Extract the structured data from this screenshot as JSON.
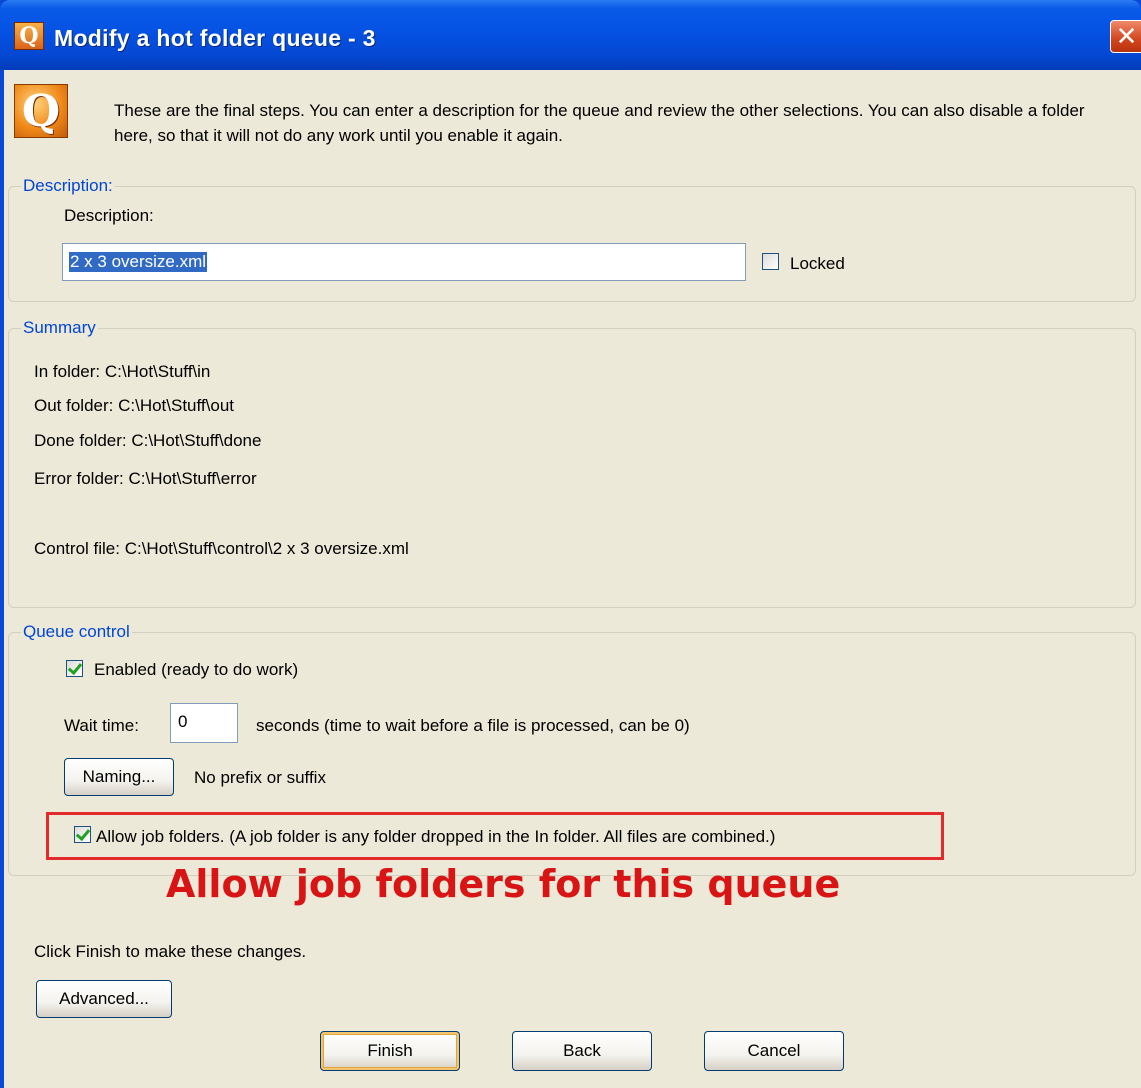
{
  "window": {
    "title": "Modify a hot folder queue - 3",
    "close_glyph": "✕",
    "app_icon_letter": "Q"
  },
  "intro": {
    "icon_letter": "Q",
    "text": "These are the final steps. You can enter a description for the queue and review the other selections. You can also disable a folder here, so that it will not do any work until you enable it again."
  },
  "description_group": {
    "legend": "Description:",
    "label": "Description:",
    "value": "2 x 3 oversize.xml",
    "locked_label": "Locked",
    "locked_checked": false
  },
  "summary_group": {
    "legend": "Summary",
    "in_folder": "In folder:  C:\\Hot\\Stuff\\in",
    "out_folder": "Out folder:  C:\\Hot\\Stuff\\out",
    "done_folder": "Done folder:  C:\\Hot\\Stuff\\done",
    "error_folder": "Error folder:  C:\\Hot\\Stuff\\error",
    "control_file": "Control file:  C:\\Hot\\Stuff\\control\\2 x 3 oversize.xml"
  },
  "queue_control": {
    "legend": "Queue control",
    "enabled_label": "Enabled (ready to do work)",
    "enabled_checked": true,
    "wait_label": "Wait time:",
    "wait_value": "0",
    "wait_hint": "seconds (time to wait before a file is processed, can be 0)",
    "naming_button": "Naming...",
    "naming_status": "No prefix or suffix",
    "job_folders_label": "Allow job folders. (A job folder is any folder dropped in the In folder. All files are combined.)",
    "job_folders_checked": true
  },
  "annotation": {
    "text": "Allow job folders for this queue",
    "color": "#d81414"
  },
  "footer": {
    "instruction": "Click Finish to make these changes.",
    "advanced_button": "Advanced...",
    "finish_button": "Finish",
    "back_button": "Back",
    "cancel_button": "Cancel"
  },
  "colors": {
    "titlebar": "#0552e3",
    "dialog_bg": "#ece9d8",
    "legend": "#0046d5",
    "highlight": "#e42b2b"
  }
}
